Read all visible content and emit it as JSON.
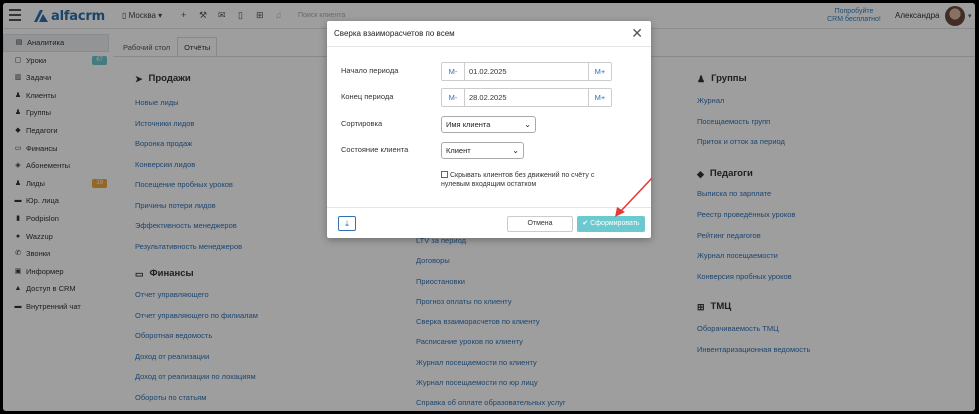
{
  "header": {
    "logo_text": "alfacrm",
    "city": "Москва",
    "search_placeholder": "Поиск клиента",
    "promo_line1": "Попробуйте",
    "promo_line2": "CRM бесплатно!",
    "username": "Александра"
  },
  "sidebar": {
    "items": [
      {
        "label": "Аналитика",
        "icon": "chart-icon"
      },
      {
        "label": "Уроки",
        "icon": "calendar-icon",
        "badge": "67",
        "badge_color": "#6cc9cf"
      },
      {
        "label": "Задачи",
        "icon": "tasks-icon"
      },
      {
        "label": "Клиенты",
        "icon": "user-icon"
      },
      {
        "label": "Группы",
        "icon": "users-icon"
      },
      {
        "label": "Педагоги",
        "icon": "graduation-icon"
      },
      {
        "label": "Финансы",
        "icon": "money-icon"
      },
      {
        "label": "Абонементы",
        "icon": "tag-icon"
      },
      {
        "label": "Лиды",
        "icon": "user-plus-icon",
        "badge": "19",
        "badge_color": "#f0a640"
      },
      {
        "label": "Юр. лица",
        "icon": "building-icon"
      },
      {
        "label": "Podpislon",
        "icon": "document-icon"
      },
      {
        "label": "Wazzup",
        "icon": "whatsapp-icon"
      },
      {
        "label": "Звонки",
        "icon": "phone-icon"
      },
      {
        "label": "Информер",
        "icon": "monitor-icon"
      },
      {
        "label": "Доступ в CRM",
        "icon": "lock-icon"
      },
      {
        "label": "Внутренний чат",
        "icon": "chat-icon"
      }
    ]
  },
  "tabs": [
    {
      "label": "Рабочий стол"
    },
    {
      "label": "Отчёты"
    }
  ],
  "reports": {
    "sales": {
      "title": "Продажи",
      "links": [
        "Новые лиды",
        "Источники лидов",
        "Воронка продаж",
        "Конверсии лидов",
        "Посещение пробных уроков",
        "Причины потери лидов",
        "Эффективность менеджеров",
        "Результативность менеджеров"
      ]
    },
    "finance": {
      "title": "Финансы",
      "links": [
        "Отчет управляющего",
        "Отчет управляющего по филиалам",
        "Оборотная ведомость",
        "Доход от реализации",
        "Доход от реализации по локациям",
        "Обороты по статьям"
      ]
    },
    "clients": {
      "links": [
        "LTV за период",
        "Договоры",
        "Приостановки",
        "Прогноз оплаты по клиенту",
        "Сверка взаиморасчетов по клиенту",
        "Расписание уроков по клиенту",
        "Журнал посещаемости по клиенту",
        "Журнал посещаемости по юр лицу",
        "Справка об оплате образовательных услуг"
      ]
    },
    "groups": {
      "title": "Группы",
      "links": [
        "Журнал",
        "Посещаемость групп",
        "Приток и отток за период"
      ]
    },
    "teachers": {
      "title": "Педагоги",
      "links": [
        "Выписка по зарплате",
        "Реестр проведённых уроков",
        "Рейтинг педагогов",
        "Журнал посещаемости",
        "Конверсия пробных уроков"
      ]
    },
    "tmc": {
      "title": "ТМЦ",
      "links": [
        "Оборачиваемость ТМЦ",
        "Инвентаризационная ведомость"
      ]
    }
  },
  "modal": {
    "title": "Сверка взаиморасчетов по всем",
    "start_label": "Начало периода",
    "start_value": "01.02.2025",
    "end_label": "Конец периода",
    "end_value": "28.02.2025",
    "minus_label": "M-",
    "plus_label": "M+",
    "sort_label": "Сортировка",
    "sort_value": "Имя клиента",
    "state_label": "Состояние клиента",
    "state_value": "Клиент",
    "hide_checkbox": "Скрывать клиентов без движений по счёту с нулевым входящим остатком",
    "cancel_label": "Отмена",
    "submit_label": "Сформировать"
  },
  "colors": {
    "accent": "#2f72b5",
    "submit": "#6cc9cf",
    "arrow": "#e53935"
  }
}
